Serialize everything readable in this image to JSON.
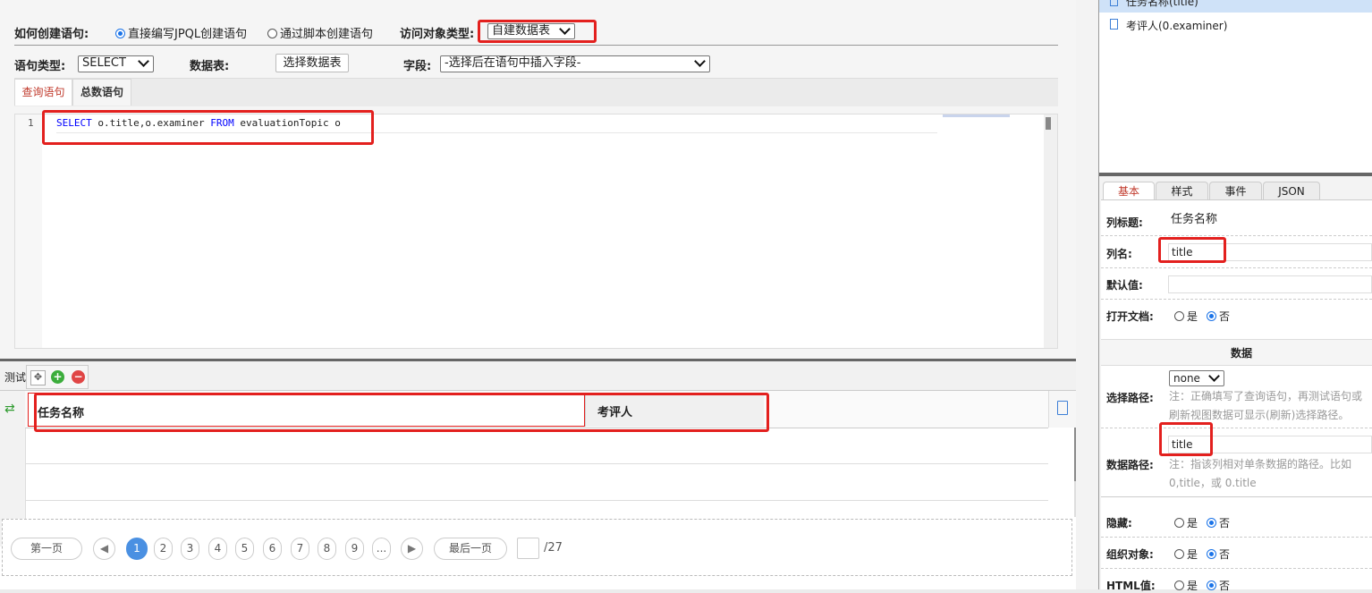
{
  "toolbar": {
    "how_label": "如何创建语句:",
    "opt_jpql": "直接编写JPQL创建语句",
    "opt_script": "通过脚本创建语句",
    "access_label": "访问对象类型:",
    "access_value": "自建数据表",
    "stmt_type_label": "语句类型:",
    "stmt_type_value": "SELECT",
    "table_label": "数据表:",
    "select_table_button": "选择数据表",
    "field_label": "字段:",
    "field_placeholder": "-选择后在语句中插入字段-"
  },
  "tabs": [
    "查询语句",
    "总数语句"
  ],
  "editor": {
    "line_no": "1",
    "tokens": [
      {
        "text": "SELECT",
        "kind": "keyword"
      },
      {
        "text": " o.title,o.examiner ",
        "kind": "plain"
      },
      {
        "text": "FROM",
        "kind": "keyword"
      },
      {
        "text": " evaluationTopic o",
        "kind": "plain"
      }
    ]
  },
  "test_panel": {
    "title": "测试",
    "columns": [
      "任务名称",
      "考评人"
    ]
  },
  "pagination": {
    "first": "第一页",
    "last": "最后一页",
    "pages": [
      "1",
      "2",
      "3",
      "4",
      "5",
      "6",
      "7",
      "8",
      "9",
      "..."
    ],
    "current": "1",
    "total": "/27"
  },
  "column_tree": {
    "items": [
      "任务名称(title)",
      "考评人(0.examiner)"
    ]
  },
  "props": {
    "tabs": [
      "基本",
      "样式",
      "事件",
      "JSON"
    ],
    "col_title_label": "列标题:",
    "col_title_value": "任务名称",
    "col_name_label": "列名:",
    "col_name_value": "title",
    "default_label": "默认值:",
    "default_value": "",
    "open_doc_label": "打开文档:",
    "yes": "是",
    "no": "否",
    "section_data": "数据",
    "select_path_label": "选择路径:",
    "select_path_value": "none",
    "select_path_note": "注：正确填写了查询语句，再测试语句或刷新视图数据可显示(刷新)选择路径。",
    "data_path_label": "数据路径:",
    "data_path_value": "title",
    "data_path_note": "注：指该列相对单条数据的路径。比如 0,title，或 0.title",
    "hidden_label": "隐藏:",
    "org_label": "组织对象:",
    "html_label": "HTML值:"
  },
  "colors": {
    "highlight": "#e3201e",
    "keyword": "#0000ff",
    "active_page": "#4a90e2",
    "active_tab": "#c0392b"
  }
}
